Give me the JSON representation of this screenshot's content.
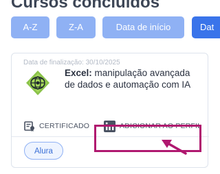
{
  "page": {
    "heading": "Cursos concluídos"
  },
  "filters": {
    "az": "A-Z",
    "za": "Z-A",
    "start_date": "Data de início",
    "last": "Dat"
  },
  "course": {
    "completion_date": "Data de finalização: 30/10/2025",
    "title_bold": "Excel:",
    "title_rest": " manipulação avançada de dados e automação com IA",
    "certificate_label": "CERTIFICADO",
    "linkedin_label": "ADICIONAR AO PERFIL",
    "tag": "Alura"
  },
  "colors": {
    "filter_light": "#8fb1f4",
    "filter_active": "#3a74ea",
    "highlight": "#b0186f",
    "logo_green": "#8bc34a"
  },
  "icons": [
    "certificate-icon",
    "linkedin-icon",
    "excel-logo"
  ]
}
